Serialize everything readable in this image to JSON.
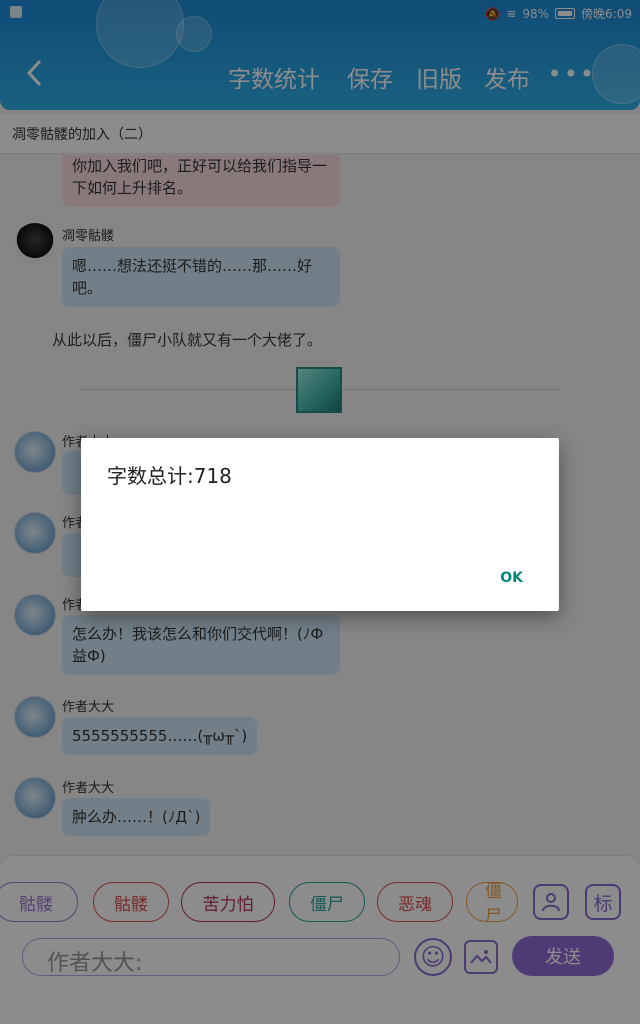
{
  "status_bar": {
    "battery": "98%",
    "time": "傍晚6:09"
  },
  "header": {
    "back_icon": "chevron-left-icon",
    "menu": [
      "字数统计",
      "保存",
      "旧版",
      "发布"
    ],
    "more": "•••"
  },
  "title": "凋零骷髅的加入（二）",
  "chat": [
    {
      "type": "msg",
      "style": "pink",
      "text": "你加入我们吧，正好可以给我们指导一下如何上升排名。"
    },
    {
      "type": "msg",
      "nick": "凋零骷髅",
      "style": "blue",
      "text": "嗯……想法还挺不错的……那……好吧。"
    },
    {
      "type": "narration",
      "text": "从此以后，僵尸小队就又有一个大佬了。"
    },
    {
      "type": "msg",
      "nick": "作者大大",
      "style": "blue",
      "text": ""
    },
    {
      "type": "msg",
      "nick": "作者大大",
      "style": "blue",
      "text": ""
    },
    {
      "type": "msg",
      "nick": "作者大大",
      "style": "blue",
      "text": "怎么办！我该怎么和你们交代啊！(ﾉФ益Ф)"
    },
    {
      "type": "msg",
      "nick": "作者大大",
      "style": "blue",
      "text": "5555555555……(╥ω╥`)"
    },
    {
      "type": "msg",
      "nick": "作者大大",
      "style": "blue",
      "text": "肿么办……！(ﾉДˋ)"
    }
  ],
  "characters": [
    "骷髅",
    "骷髅",
    "苦力怕",
    "僵尸",
    "恶魂",
    "僵尸"
  ],
  "toolbar": {
    "user_icon": "user-icon",
    "tag_label": "标",
    "input_placeholder": "作者大大:",
    "emoji_icon": "smile-icon",
    "image_icon": "image-icon",
    "send_label": "发送"
  },
  "dialog": {
    "title": "字数总计:718",
    "ok_label": "OK"
  }
}
